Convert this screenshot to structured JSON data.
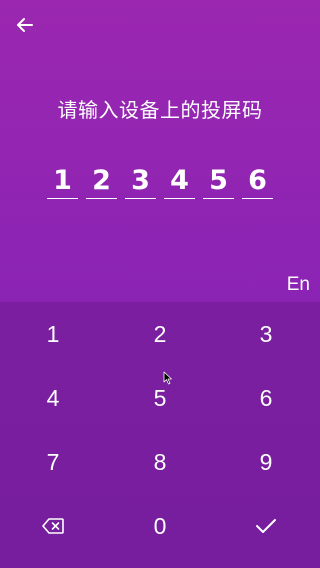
{
  "header": {
    "back_icon": "arrow-left-icon",
    "title": "请输入设备上的投屏码"
  },
  "code": {
    "digits": [
      "1",
      "2",
      "3",
      "4",
      "5",
      "6"
    ]
  },
  "language_toggle": {
    "label": "En"
  },
  "keypad": {
    "keys": [
      "1",
      "2",
      "3",
      "4",
      "5",
      "6",
      "7",
      "8",
      "9"
    ],
    "zero": "0",
    "delete_icon": "backspace-icon",
    "confirm_icon": "checkmark-icon"
  },
  "colors": {
    "background_top": "#9b27b0",
    "keypad_background": "#7b1fa0",
    "text": "#ffffff"
  }
}
